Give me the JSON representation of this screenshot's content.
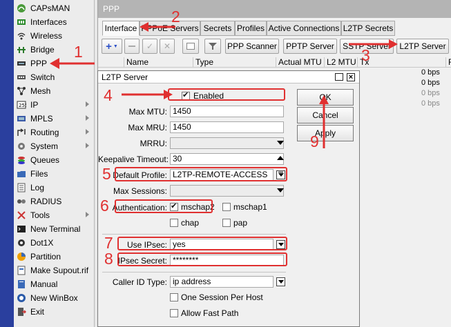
{
  "sidebar": {
    "items": [
      {
        "label": "CAPsMAN",
        "icon": "capsman-icon",
        "submenu": false
      },
      {
        "label": "Interfaces",
        "icon": "interfaces-icon",
        "submenu": false
      },
      {
        "label": "Wireless",
        "icon": "wireless-icon",
        "submenu": false
      },
      {
        "label": "Bridge",
        "icon": "bridge-icon",
        "submenu": false
      },
      {
        "label": "PPP",
        "icon": "ppp-icon",
        "submenu": false
      },
      {
        "label": "Switch",
        "icon": "switch-icon",
        "submenu": false
      },
      {
        "label": "Mesh",
        "icon": "mesh-icon",
        "submenu": false
      },
      {
        "label": "IP",
        "icon": "ip-icon",
        "submenu": true
      },
      {
        "label": "MPLS",
        "icon": "mpls-icon",
        "submenu": true
      },
      {
        "label": "Routing",
        "icon": "routing-icon",
        "submenu": true
      },
      {
        "label": "System",
        "icon": "system-icon",
        "submenu": true
      },
      {
        "label": "Queues",
        "icon": "queues-icon",
        "submenu": false
      },
      {
        "label": "Files",
        "icon": "files-icon",
        "submenu": false
      },
      {
        "label": "Log",
        "icon": "log-icon",
        "submenu": false
      },
      {
        "label": "RADIUS",
        "icon": "radius-icon",
        "submenu": false
      },
      {
        "label": "Tools",
        "icon": "tools-icon",
        "submenu": true
      },
      {
        "label": "New Terminal",
        "icon": "terminal-icon",
        "submenu": false
      },
      {
        "label": "Dot1X",
        "icon": "dot1x-icon",
        "submenu": false
      },
      {
        "label": "Partition",
        "icon": "partition-icon",
        "submenu": false
      },
      {
        "label": "Make Supout.rif",
        "icon": "supout-icon",
        "submenu": false
      },
      {
        "label": "Manual",
        "icon": "manual-icon",
        "submenu": false
      },
      {
        "label": "New WinBox",
        "icon": "winbox-icon",
        "submenu": false
      },
      {
        "label": "Exit",
        "icon": "exit-icon",
        "submenu": false
      }
    ]
  },
  "ppp": {
    "title": "PPP",
    "tabs": [
      "Interface",
      "PPPoE Servers",
      "Secrets",
      "Profiles",
      "Active Connections",
      "L2TP Secrets"
    ],
    "active_tab": "Interface",
    "toolbar": {
      "add": "+",
      "ppp_scanner": "PPP Scanner",
      "pptp_server": "PPTP Server",
      "sstp_server": "SSTP Server",
      "l2tp_server": "L2TP Server"
    },
    "columns": [
      "Name",
      "Type",
      "Actual MTU",
      "L2 MTU",
      "Tx",
      "Rx"
    ],
    "tx_values": [
      "0 bps",
      "0 bps",
      "0 bps",
      "0 bps"
    ]
  },
  "dialog": {
    "title": "L2TP Server",
    "enabled": {
      "label": "Enabled",
      "checked": true
    },
    "max_mtu": {
      "label": "Max MTU:",
      "value": "1450"
    },
    "max_mru": {
      "label": "Max MRU:",
      "value": "1450"
    },
    "mrru": {
      "label": "MRRU:",
      "value": ""
    },
    "keepalive": {
      "label": "Keepalive Timeout:",
      "value": "30"
    },
    "default_profile": {
      "label": "Default Profile:",
      "value": "L2TP-REMOTE-ACCESS"
    },
    "max_sessions": {
      "label": "Max Sessions:",
      "value": ""
    },
    "authentication": {
      "label": "Authentication:",
      "options": [
        {
          "label": "mschap2",
          "checked": true
        },
        {
          "label": "mschap1",
          "checked": false
        },
        {
          "label": "chap",
          "checked": false
        },
        {
          "label": "pap",
          "checked": false
        }
      ]
    },
    "use_ipsec": {
      "label": "Use IPsec:",
      "value": "yes"
    },
    "ipsec_secret": {
      "label": "IPsec Secret:",
      "value": "********"
    },
    "caller_id_type": {
      "label": "Caller ID Type:",
      "value": "ip address"
    },
    "one_session": {
      "label": "One Session Per Host",
      "checked": false
    },
    "allow_fast_path": {
      "label": "Allow Fast Path",
      "checked": false
    },
    "buttons": {
      "ok": "OK",
      "cancel": "Cancel",
      "apply": "Apply"
    }
  },
  "annotations": {
    "numbers": [
      "1",
      "2",
      "3",
      "4",
      "5",
      "6",
      "7",
      "8",
      "9"
    ],
    "color": "#e03030"
  },
  "colors": {
    "sidebar_bar": "#2a3f9e",
    "annotation_red": "#e03030",
    "titlebar_gray": "#b4b4b4"
  }
}
